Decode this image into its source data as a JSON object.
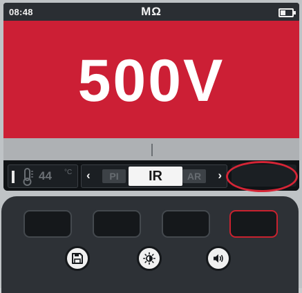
{
  "status_bar": {
    "time": "08:48",
    "unit": "MΩ",
    "battery_icon": "battery-icon"
  },
  "main": {
    "voltage": "500V",
    "background_color": "#cc1f35"
  },
  "softkeys": {
    "temperature": {
      "icon": "thermometer-icon",
      "value": "44",
      "unit": "°C"
    },
    "mode_selector": {
      "left_arrow": "‹",
      "right_arrow": "›",
      "options": [
        "PI",
        "IR",
        "AR"
      ],
      "selected": "IR",
      "prev_visible": "PI",
      "next_visible": "AR"
    },
    "highlight_color": "#d52536"
  },
  "keypad": {
    "function_keys": [
      "",
      "",
      "",
      ""
    ],
    "bottom_buttons": [
      {
        "icon": "save-icon"
      },
      {
        "icon": "brightness-icon"
      },
      {
        "icon": "volume-icon"
      }
    ]
  }
}
